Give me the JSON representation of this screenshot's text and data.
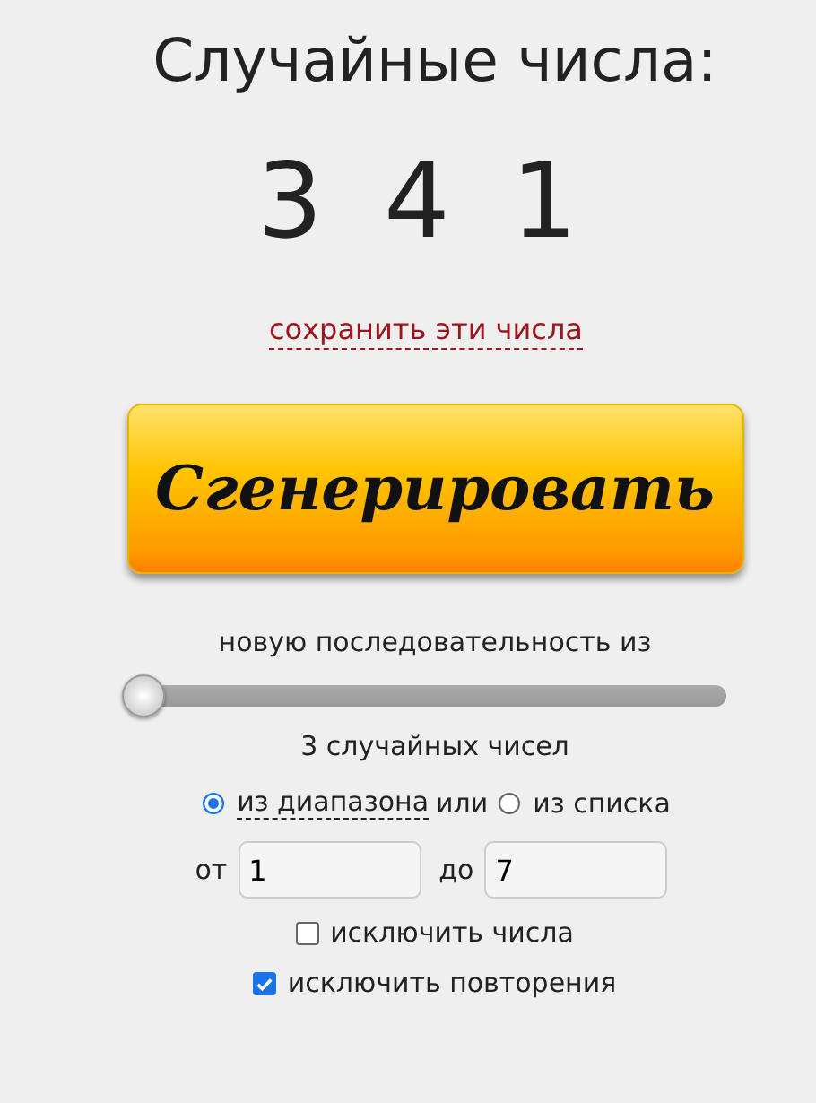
{
  "title": "Случайные числа:",
  "numbers": [
    "3",
    "4",
    "1"
  ],
  "save_link": "сохранить эти числа",
  "generate_button": "Сгенерировать",
  "sequence_label": "новую последовательность из",
  "count_slider": {
    "level": 0
  },
  "count_label": "3 случайных чисел",
  "source_options": [
    {
      "label": "из диапазона",
      "selected": true
    },
    {
      "label": "из списка",
      "selected": false
    }
  ],
  "source_joiner": "или",
  "range": {
    "from_label": "от",
    "from_value": "1",
    "to_label": "до",
    "to_value": "7"
  },
  "options": [
    {
      "label": "исключить числа",
      "checked": false
    },
    {
      "label": "исключить повторения",
      "checked": true
    }
  ]
}
